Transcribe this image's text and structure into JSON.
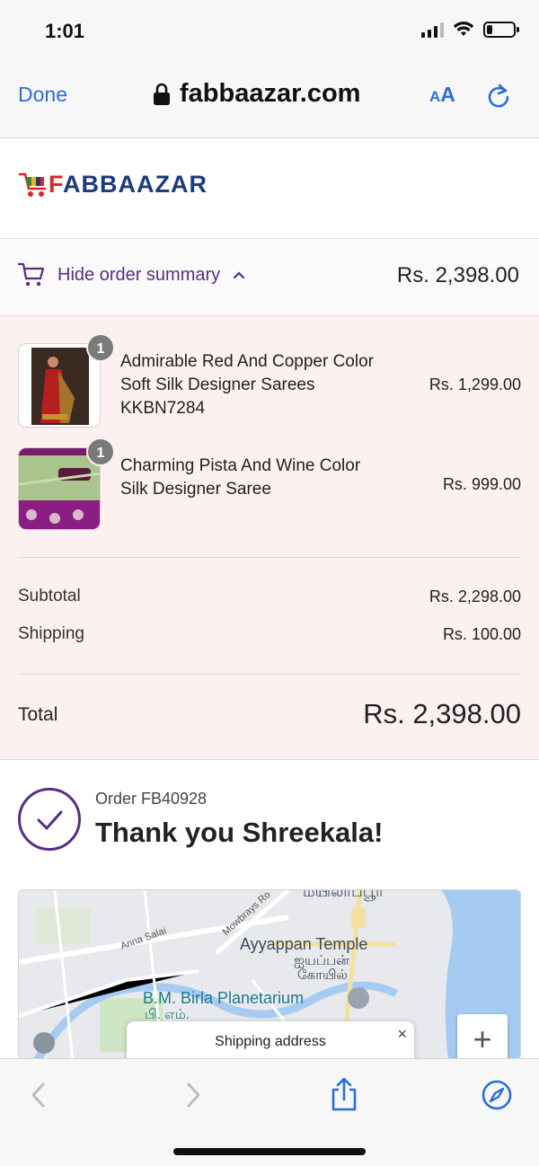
{
  "status_bar": {
    "time": "1:01"
  },
  "browser": {
    "done_label": "Done",
    "url": "fabbaazar.com",
    "aa_small": "A",
    "aa_big": "A"
  },
  "site": {
    "logo_f": "F",
    "logo_rest": "ABBAAZAR"
  },
  "summary_toggle": {
    "label": "Hide order summary",
    "total": "Rs. 2,398.00"
  },
  "products": [
    {
      "quantity": "1",
      "name": "Admirable Red And Copper Color Soft Silk Designer Sarees KKBN7284",
      "price": "Rs. 1,299.00"
    },
    {
      "quantity": "1",
      "name": "Charming Pista And Wine Color Silk Designer Saree",
      "price": "Rs. 999.00"
    }
  ],
  "totals": {
    "subtotal_label": "Subtotal",
    "subtotal_value": "Rs. 2,298.00",
    "shipping_label": "Shipping",
    "shipping_value": "Rs. 100.00",
    "total_label": "Total",
    "total_value": "Rs. 2,398.00"
  },
  "confirmation": {
    "order_number": "Order FB40928",
    "title": "Thank you Shreekala!"
  },
  "map": {
    "labels": {
      "anna_salai": "Anna Salai",
      "mowbrays": "Mowbrays Ro",
      "mylapore_tamil": "மயிலாப்பூர்",
      "ayyappan": "Ayyappan Temple",
      "ayyappan_tamil_1": "ஐயப்பன்",
      "ayyappan_tamil_2": "கோயில்",
      "planetarium": "B.M. Birla Planetarium",
      "planetarium_tamil": "பி. எம்."
    },
    "zoom_in_label": "+",
    "popup_label": "Shipping address",
    "popup_close": "×"
  },
  "colors": {
    "accent": "#5a2d82",
    "link_blue": "#2a6fd6",
    "summary_bg": "#fdf0f0"
  }
}
